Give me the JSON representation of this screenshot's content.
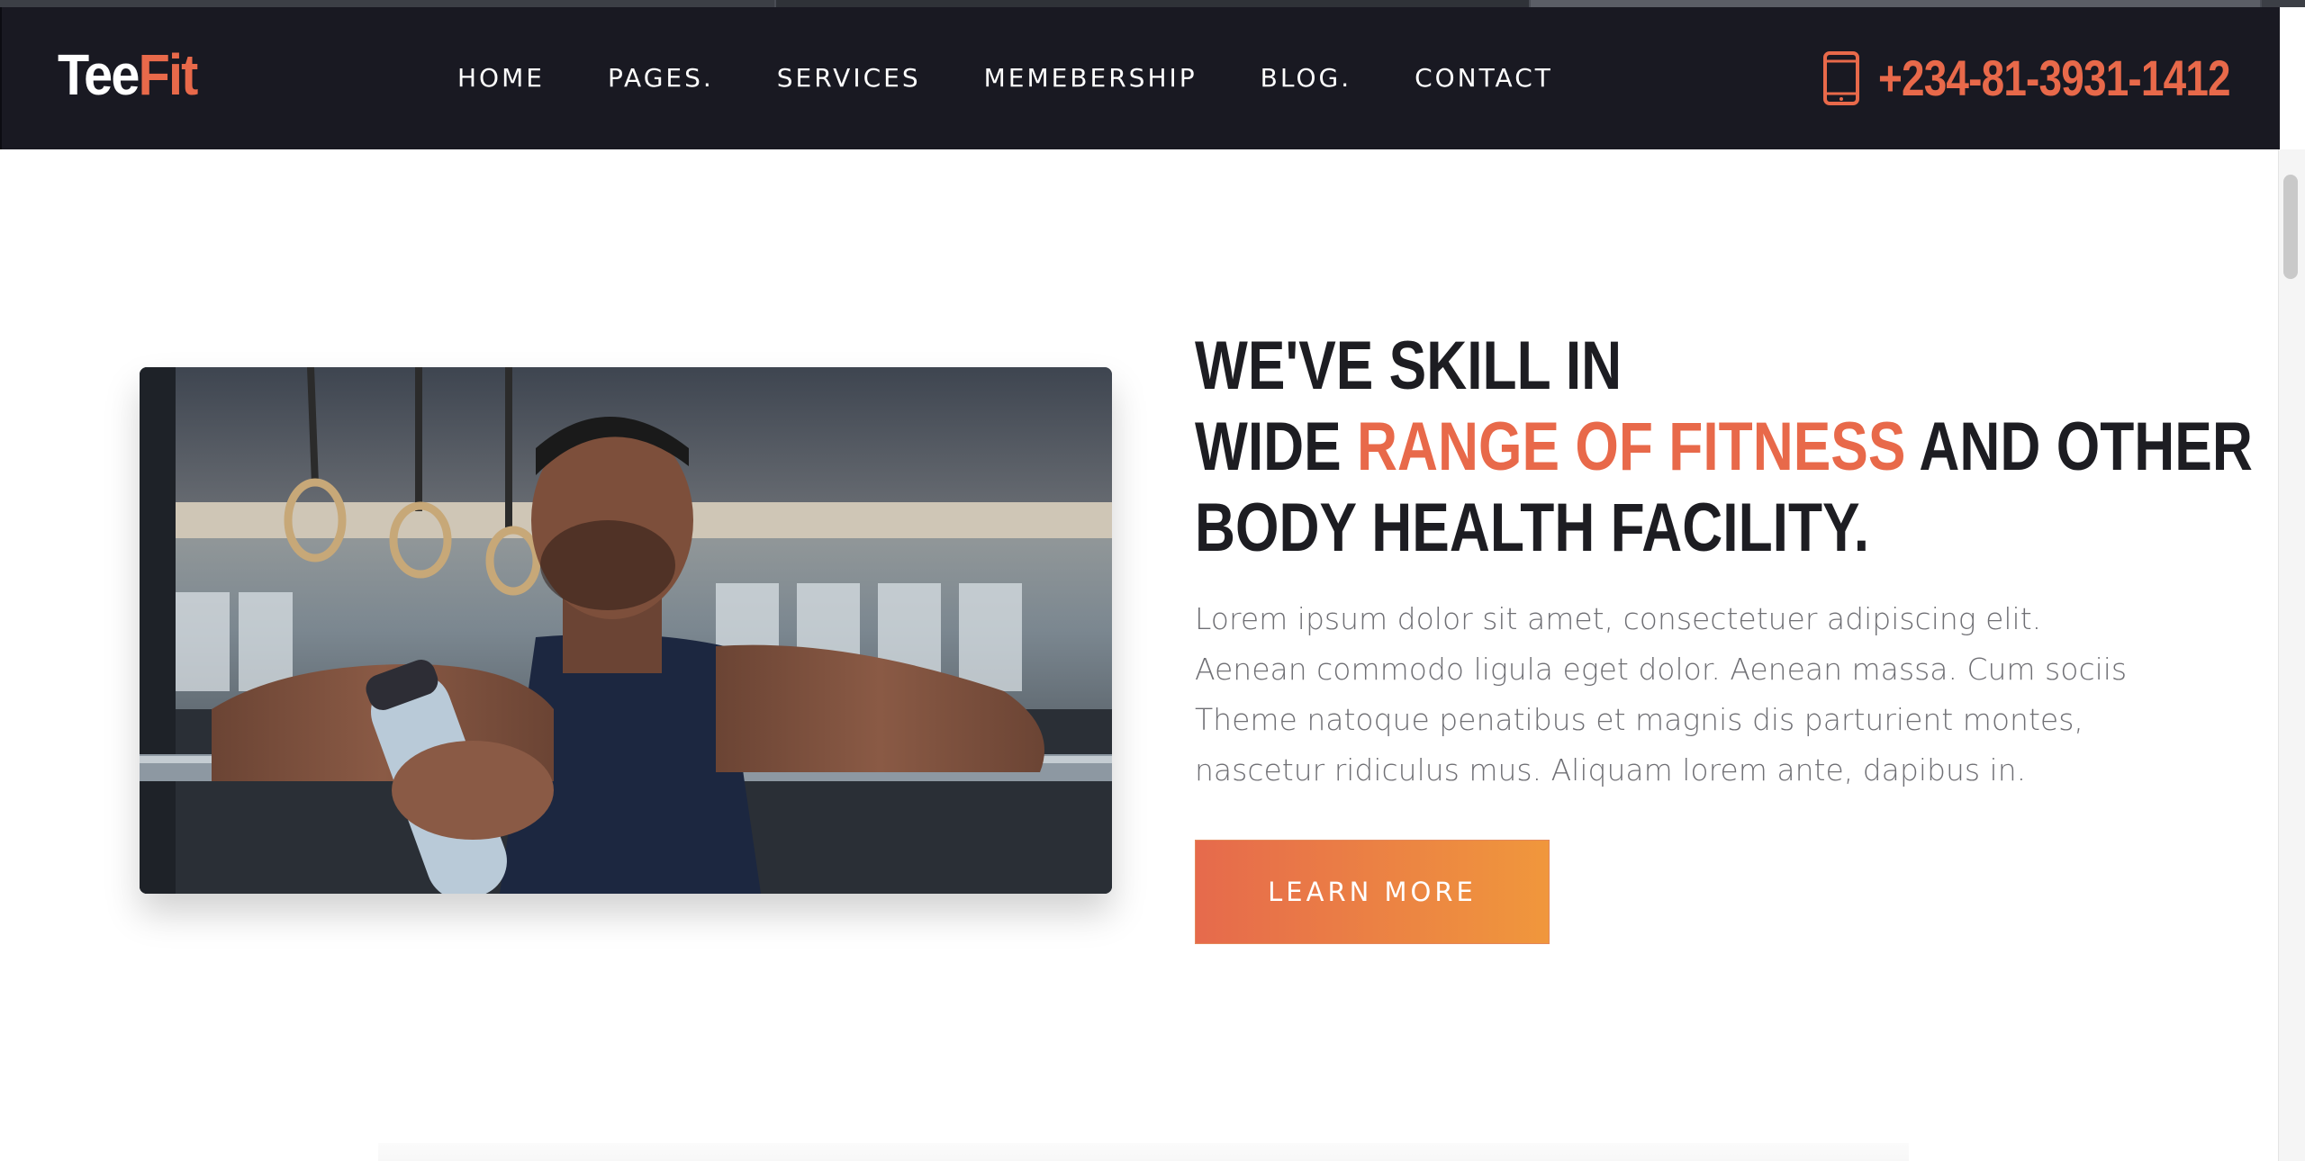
{
  "brand": {
    "logo_part1": "Tee",
    "logo_part2": "Fit",
    "accent_color": "#e8694a",
    "header_bg": "#191922"
  },
  "nav": {
    "items": [
      {
        "label": "HOME"
      },
      {
        "label": "PAGES."
      },
      {
        "label": "SERVICES"
      },
      {
        "label": "MEMEBERSHIP"
      },
      {
        "label": "BLOG."
      },
      {
        "label": "CONTACT"
      }
    ]
  },
  "contact": {
    "phone": "+234-81-3931-1412",
    "icon": "mobile-phone-icon"
  },
  "hero": {
    "headline_line1": "WE'VE SKILL IN",
    "headline_line2_start": "WIDE ",
    "headline_line2_accent": "RANGE OF FITNESS",
    "headline_line2_end": " AND OTHER",
    "headline_line3": "BODY HEALTH FACILITY.",
    "body": "Lorem ipsum dolor sit amet, consectetuer adipiscing elit. Aenean commodo ligula eget dolor. Aenean massa. Cum sociis Theme natoque penatibus et magnis dis parturient montes, nascetur ridiculus mus. Aliquam lorem ante, dapibus in.",
    "cta_label": "LEARN MORE",
    "cta_gradient": [
      "#e66a4c",
      "#f0973c"
    ]
  }
}
